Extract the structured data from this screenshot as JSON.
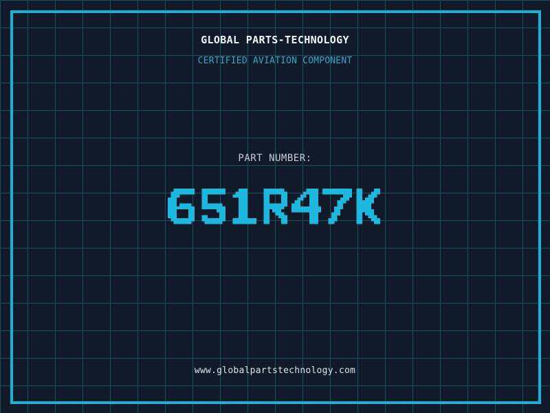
{
  "colors": {
    "background": "#101a28",
    "grid_line": "#1d4f63",
    "frame": "#16b2da",
    "title": "#f2f5f7",
    "subtitle": "#2fa8cd",
    "label": "#c9ced6",
    "part_number": "#1cb8e0",
    "url": "#dfe3e6"
  },
  "header": {
    "title": "GLOBAL PARTS-TECHNOLOGY",
    "subtitle": "CERTIFIED AVIATION COMPONENT"
  },
  "part": {
    "label": "PART NUMBER:",
    "value": "651R47K"
  },
  "footer": {
    "url": "www.globalpartstechnology.com"
  }
}
